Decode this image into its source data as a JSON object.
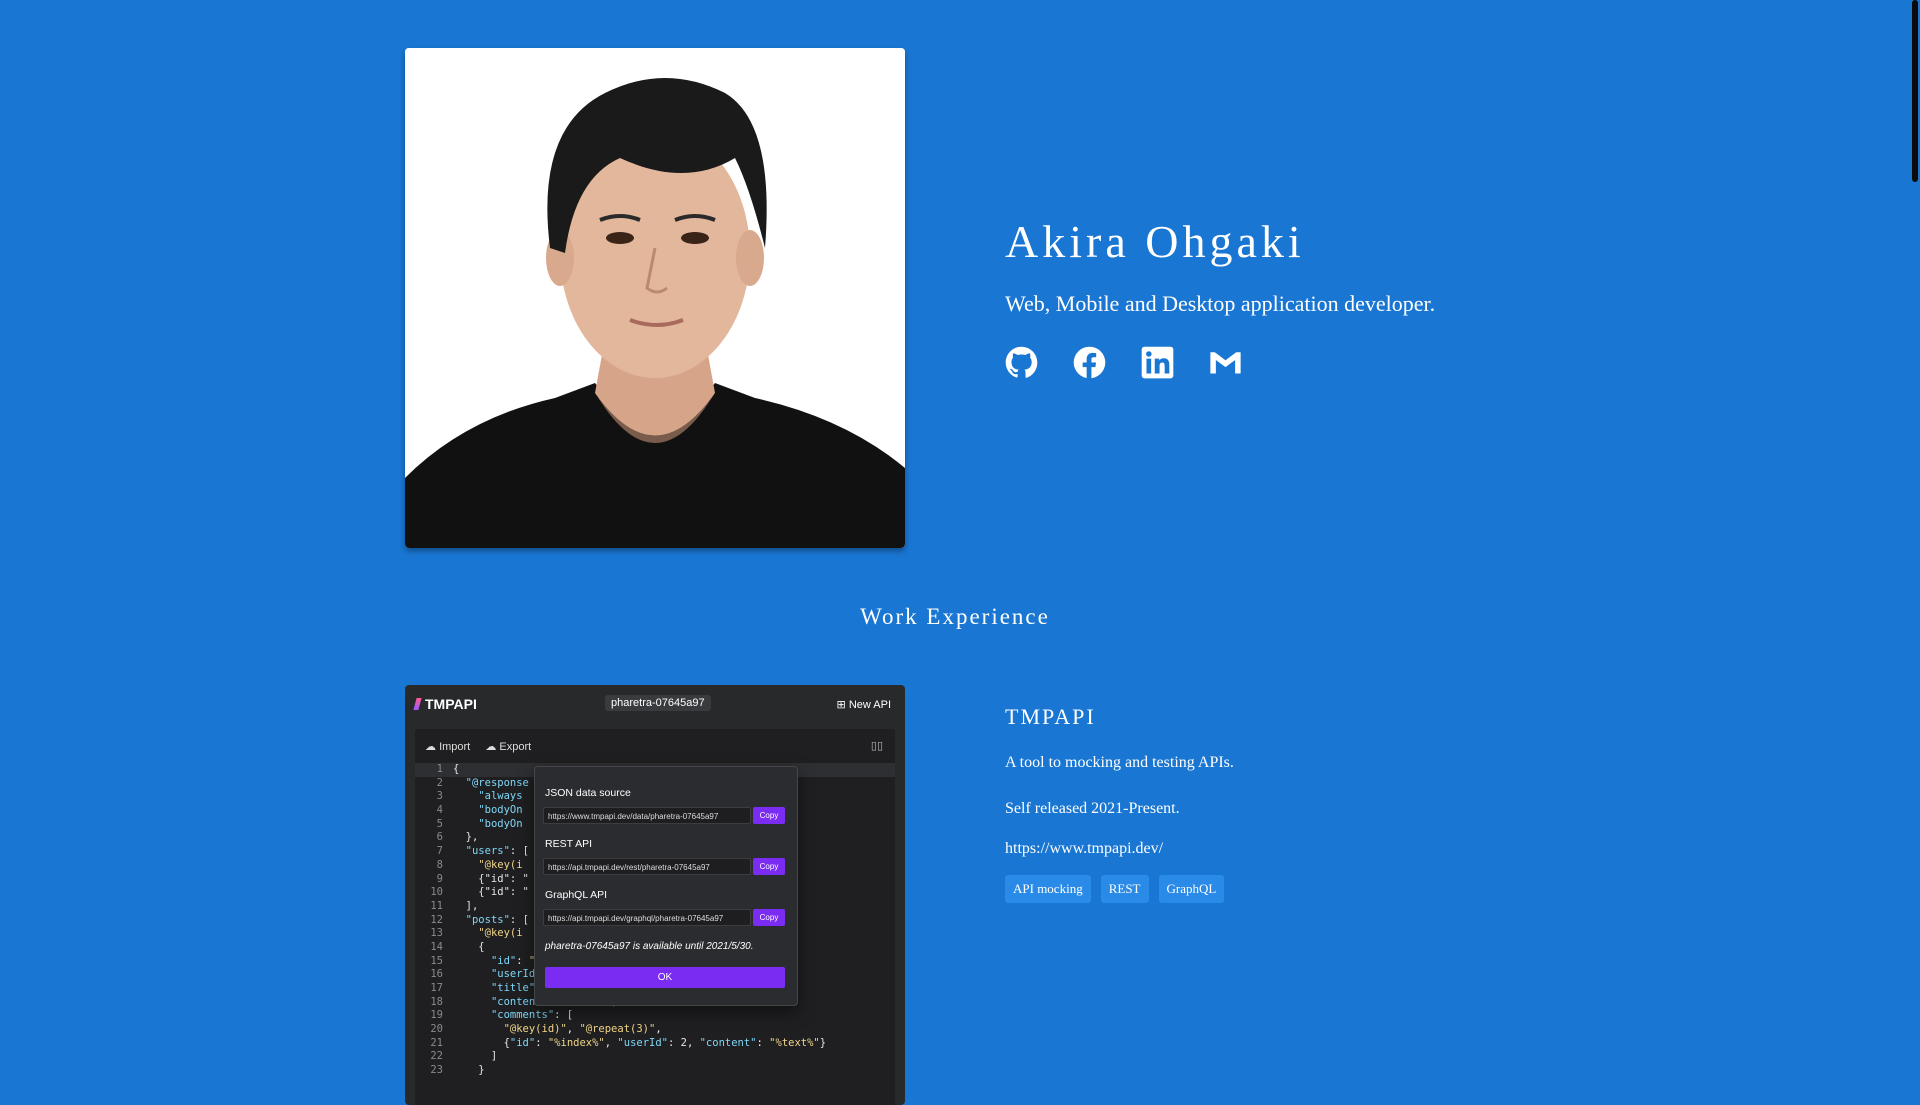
{
  "profile": {
    "name": "Akira Ohgaki",
    "tagline": "Web, Mobile and Desktop application developer.",
    "socials": [
      {
        "icon": "github-icon"
      },
      {
        "icon": "facebook-icon"
      },
      {
        "icon": "linkedin-icon"
      },
      {
        "icon": "gmail-icon"
      }
    ]
  },
  "work_section": {
    "title": "Work Experience"
  },
  "work": {
    "name": "TMPAPI",
    "description": "A tool to mocking and testing APIs.",
    "period": "Self released 2021-Present.",
    "link": "https://www.tmpapi.dev/",
    "tags": [
      "API mocking",
      "REST",
      "GraphQL"
    ]
  },
  "screenshot": {
    "logo": "TMPAPI",
    "api_id": "pharetra-07645a97",
    "new_api": "New API",
    "import": "Import",
    "export": "Export",
    "json_label": "JSON data source",
    "json_url": "https://www.tmpapi.dev/data/pharetra-07645a97",
    "rest_label": "REST API",
    "rest_url": "https://api.tmpapi.dev/rest/pharetra-07645a97",
    "graphql_label": "GraphQL API",
    "graphql_url": "https://api.tmpapi.dev/graphql/pharetra-07645a97",
    "copy": "Copy",
    "availability": "pharetra-07645a97 is available until 2021/5/30.",
    "ok": "OK"
  },
  "colors": {
    "background": "#1976d2",
    "tag_bg": "#2a8ae8",
    "dialog_accent": "#7b2cf2"
  }
}
